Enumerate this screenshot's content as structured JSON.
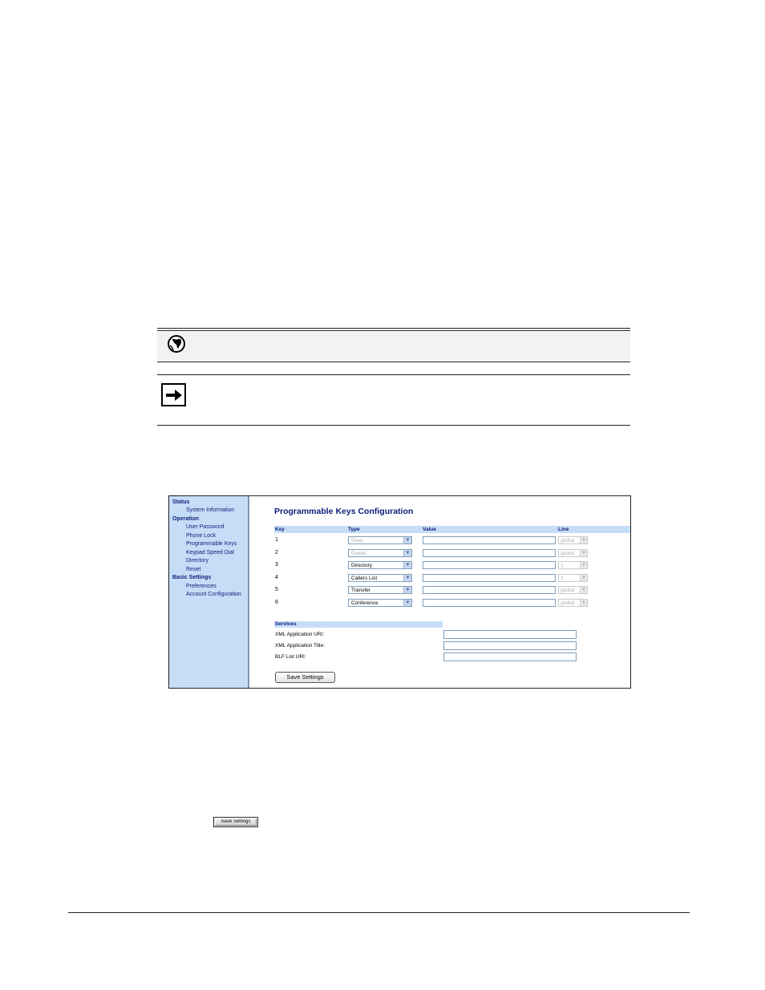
{
  "icons": {
    "reference": "globe-icon",
    "note": "arrow-right-icon"
  },
  "screenshot": {
    "nav": [
      {
        "label": "Status",
        "type": "heading"
      },
      {
        "label": "System Information",
        "type": "item"
      },
      {
        "label": "Operation",
        "type": "heading"
      },
      {
        "label": "User Password",
        "type": "item"
      },
      {
        "label": "Phone Lock",
        "type": "item"
      },
      {
        "label": "Programmable Keys",
        "type": "item"
      },
      {
        "label": "Keypad Speed Dial",
        "type": "item"
      },
      {
        "label": "Directory",
        "type": "item"
      },
      {
        "label": "Reset",
        "type": "item"
      },
      {
        "label": "Basic Settings",
        "type": "heading"
      },
      {
        "label": "Preferences",
        "type": "item"
      },
      {
        "label": "Account Configuration",
        "type": "item"
      }
    ],
    "title": "Programmable Keys Configuration",
    "headers": {
      "key": "Key",
      "type": "Type",
      "value": "Value",
      "line": "Line"
    },
    "keys": [
      {
        "key": "1",
        "type": "Save",
        "type_disabled": true,
        "value": "",
        "line": "global"
      },
      {
        "key": "2",
        "type": "Delete",
        "type_disabled": true,
        "value": "",
        "line": "global"
      },
      {
        "key": "3",
        "type": "Directory",
        "type_disabled": false,
        "value": "",
        "line": "1"
      },
      {
        "key": "4",
        "type": "Callers List",
        "type_disabled": false,
        "value": "",
        "line": "1"
      },
      {
        "key": "5",
        "type": "Transfer",
        "type_disabled": false,
        "value": "",
        "line": "global"
      },
      {
        "key": "6",
        "type": "Conference",
        "type_disabled": false,
        "value": "",
        "line": "global"
      }
    ],
    "services": {
      "title": "Services",
      "xml_uri_label": "XML Application URI:",
      "xml_title_label": "XML Application Title:",
      "blf_uri_label": "BLF List URI:"
    },
    "save_button": "Save Settings"
  },
  "inline_button": "Save Settings"
}
